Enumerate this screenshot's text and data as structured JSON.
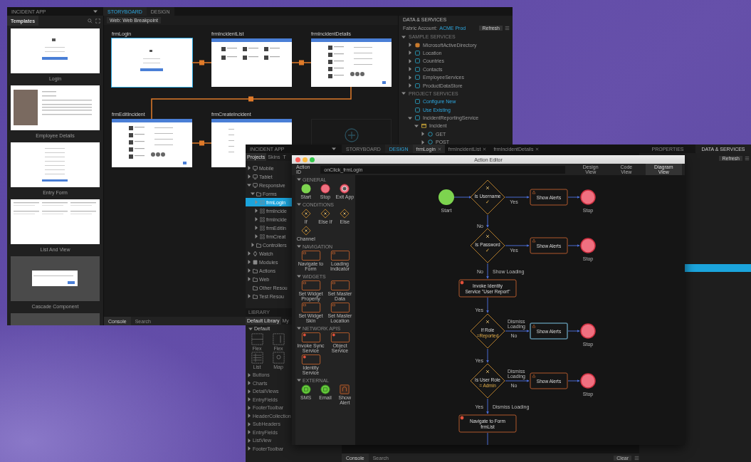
{
  "back_window": {
    "app_title": "INCIDENT APP",
    "tabs": [
      {
        "label": "STORYBOARD",
        "selected": true
      },
      {
        "label": "DESIGN",
        "selected": false
      }
    ],
    "templates": {
      "title": "Templates",
      "items": [
        {
          "kind": "login",
          "label": "Login"
        },
        {
          "kind": "profile",
          "label": "Employee Details"
        },
        {
          "kind": "form",
          "label": "Entry Form"
        },
        {
          "kind": "list",
          "label": "List And View"
        },
        {
          "kind": "dialog",
          "label": "Cascade Component"
        },
        {
          "kind": "blank"
        }
      ]
    },
    "breakpoint": "Web: Web Breakpoint",
    "forms": [
      {
        "name": "frmLogin",
        "kind": "login",
        "selected": true
      },
      {
        "name": "frmIncidentList",
        "kind": "list",
        "selected": false
      },
      {
        "name": "frmIncidentDetails",
        "kind": "details",
        "selected": false
      },
      {
        "name": "frmEditIncident",
        "kind": "details",
        "selected": false
      },
      {
        "name": "frmCreateIncident",
        "kind": "create",
        "selected": false
      }
    ],
    "console_tabs": [
      {
        "label": "Console",
        "selected": true
      },
      {
        "label": "Search",
        "selected": false
      }
    ]
  },
  "data_services": {
    "title": "DATA & SERVICES",
    "account_label": "Fabric Account:",
    "account_value": "ACME Prod",
    "refresh": "Refresh",
    "tree": [
      {
        "label": "SAMPLE SERVICES",
        "kind": "section",
        "expanded": true,
        "children": [
          {
            "label": "MicrosoftActiveDirectory",
            "kind": "service-orange",
            "expanded": false
          },
          {
            "label": "Location",
            "kind": "service",
            "expanded": false
          },
          {
            "label": "Countries",
            "kind": "service",
            "expanded": false
          },
          {
            "label": "Contacts",
            "kind": "service",
            "expanded": false
          },
          {
            "label": "EmployeeServices",
            "kind": "service",
            "expanded": false
          },
          {
            "label": "ProductDataStore",
            "kind": "service",
            "expanded": false
          }
        ]
      },
      {
        "label": "PROJECT SERVICES",
        "kind": "section",
        "expanded": true,
        "children": [
          {
            "label": "Configure New",
            "kind": "link"
          },
          {
            "label": "Use Existing",
            "kind": "link"
          },
          {
            "label": "IncidentReportingService",
            "kind": "service",
            "expanded": true,
            "children": [
              {
                "label": "Incident",
                "kind": "object",
                "expanded": true,
                "children": [
                  {
                    "label": "GET",
                    "kind": "operation",
                    "expanded": false
                  },
                  {
                    "label": "POST",
                    "kind": "operation",
                    "expanded": false
                  }
                ]
              }
            ]
          }
        ]
      }
    ]
  },
  "front_window": {
    "app_title": "INCIDENT APP",
    "tabs": [
      {
        "label": "STORYBOARD",
        "selected": false
      },
      {
        "label": "DESIGN",
        "selected": true
      }
    ],
    "open_forms": [
      {
        "label": "frmLogin",
        "selected": true
      },
      {
        "label": "frmIncidentList",
        "selected": false
      },
      {
        "label": "frmIncidentDetails",
        "selected": false
      }
    ],
    "panel_tabs": [
      {
        "label": "PROPERTIES",
        "selected": false
      },
      {
        "label": "DATA & SERVICES",
        "selected": true
      }
    ],
    "project_tabs": [
      {
        "label": "Projects",
        "selected": true
      },
      {
        "label": "Skins",
        "selected": false
      },
      {
        "label": "T",
        "selected": false
      }
    ],
    "project_tree": [
      {
        "label": "Mobile",
        "kind": "device",
        "expanded": false,
        "selected": false
      },
      {
        "label": "Tablet",
        "kind": "device",
        "expanded": false,
        "selected": false
      },
      {
        "label": "Responsive",
        "kind": "device",
        "expanded": true,
        "selected": false,
        "children": [
          {
            "label": "Forms",
            "kind": "folder",
            "expanded": true,
            "selected": false,
            "children": [
              {
                "label": "frmLogin",
                "kind": "form",
                "expanded": false,
                "selected": true
              },
              {
                "label": "frmIncide",
                "kind": "form",
                "expanded": false,
                "selected": false
              },
              {
                "label": "frmIncide",
                "kind": "form",
                "expanded": false,
                "selected": false
              },
              {
                "label": "frmEditIn",
                "kind": "form",
                "expanded": false,
                "selected": false
              },
              {
                "label": "frmCreat",
                "kind": "form",
                "expanded": false,
                "selected": false
              }
            ]
          },
          {
            "label": "Controllers",
            "kind": "folder",
            "expanded": false,
            "selected": false
          }
        ]
      },
      {
        "label": "Watch",
        "kind": "watch",
        "expanded": false,
        "selected": false
      },
      {
        "label": "Modules",
        "kind": "module",
        "expanded": false,
        "selected": false
      },
      {
        "label": "Actions",
        "kind": "folder",
        "expanded": false,
        "selected": false
      },
      {
        "label": "Web",
        "kind": "folder",
        "expanded": false,
        "selected": false
      },
      {
        "label": "Other Resou",
        "kind": "folder",
        "selected": false
      },
      {
        "label": "Test Resou",
        "kind": "folder",
        "expanded": false,
        "selected": false
      }
    ],
    "library": {
      "title": "LIBRARY",
      "tabs": [
        {
          "label": "Default Library",
          "selected": true
        },
        {
          "label": "My",
          "selected": false
        }
      ],
      "group": "Default",
      "group_expanded": true,
      "widgets": [
        {
          "label": "Flex",
          "kind": "flex-h"
        },
        {
          "label": "Flex",
          "kind": "flex-v"
        },
        {
          "label": "List",
          "kind": "list"
        },
        {
          "label": "Map",
          "kind": "map"
        }
      ],
      "categories": [
        "Buttons",
        "Charts",
        "DetailViews",
        "EntryFields",
        "FooterToolbar",
        "HeaderCollection",
        "SubHeaders",
        "EntryFields",
        "ListView",
        "FooterToolbar"
      ]
    },
    "console_tabs": [
      {
        "label": "Console",
        "selected": true
      },
      {
        "label": "Search",
        "selected": false
      }
    ],
    "clear": "Clear",
    "refresh": "Refresh"
  },
  "action_editor": {
    "title": "Action Editor",
    "action_id_label": "Action ID",
    "action_id": "onClick_frmLogin",
    "views": [
      {
        "label": "Design View",
        "selected": false
      },
      {
        "label": "Code View",
        "selected": false
      },
      {
        "label": "Diagram View",
        "selected": true
      }
    ],
    "palette": [
      {
        "title": "GENERAL",
        "expanded": true,
        "items": [
          {
            "label": "Start",
            "kind": "start"
          },
          {
            "label": "Stop",
            "kind": "stop"
          },
          {
            "label": "Exit App",
            "kind": "exit"
          }
        ]
      },
      {
        "title": "CONDITIONS",
        "expanded": true,
        "items": [
          {
            "label": "If",
            "kind": "condition"
          },
          {
            "label": "Else If",
            "kind": "condition"
          },
          {
            "label": "Else",
            "kind": "condition"
          },
          {
            "label": "Channel",
            "kind": "condition"
          }
        ]
      },
      {
        "title": "NAVIGATION",
        "expanded": true,
        "items": [
          {
            "label": "Navigate to Form",
            "kind": "action"
          },
          {
            "label": "Loading Indicator",
            "kind": "action"
          }
        ]
      },
      {
        "title": "WIDGETS",
        "expanded": true,
        "items": [
          {
            "label": "Set Widget Property",
            "kind": "action"
          },
          {
            "label": "Set Master Data",
            "kind": "action"
          },
          {
            "label": "Set Widget Skin",
            "kind": "action"
          },
          {
            "label": "Set Master Location",
            "kind": "action"
          }
        ]
      },
      {
        "title": "NETWORK APIS",
        "expanded": true,
        "items": [
          {
            "label": "Invoke Sync Service",
            "kind": "service"
          },
          {
            "label": "Object Service",
            "kind": "service"
          },
          {
            "label": "Identity Service",
            "kind": "service"
          }
        ]
      },
      {
        "title": "EXTERNAL",
        "expanded": true,
        "items": [
          {
            "label": "SMS",
            "kind": "message"
          },
          {
            "label": "Email",
            "kind": "message"
          },
          {
            "label": "Show Alert",
            "kind": "alert"
          }
        ]
      }
    ],
    "flow": {
      "start": "Start",
      "steps": [
        {
          "kind": "decision",
          "lines": [
            "Is Username",
            "✓"
          ],
          "branch": {
            "below": "Yes",
            "action": "Show Alerts",
            "highlighted": false,
            "stop": "Stop"
          },
          "down": [
            "No"
          ]
        },
        {
          "kind": "decision",
          "lines": [
            "Is Password",
            "✓"
          ],
          "branch": {
            "below": "Yes",
            "action": "Show Alerts",
            "highlighted": false,
            "stop": "Stop"
          },
          "down": [
            "No",
            "Show Loading"
          ]
        },
        {
          "kind": "action",
          "lines": [
            "Invoke Identity",
            "Service \"User Report\""
          ],
          "down": [
            "Yes"
          ]
        },
        {
          "kind": "decision",
          "lines": [
            "If Role",
            "=Reported"
          ],
          "branch": {
            "above": "Dismiss Loading",
            "below": "No",
            "action": "Show Alerts",
            "highlighted": true,
            "stop": "Stop"
          },
          "down": [
            "Yes"
          ]
        },
        {
          "kind": "decision",
          "lines": [
            "Is User Role",
            "= Admin"
          ],
          "branch": {
            "above": "Dismiss Loading",
            "below": "No",
            "action": "Show Alerts",
            "highlighted": false,
            "stop": "Stop"
          },
          "down": [
            "Yes",
            "Dismiss Loading"
          ]
        },
        {
          "kind": "action",
          "lines": [
            "Navigate to Form",
            "frmList"
          ]
        }
      ]
    }
  }
}
